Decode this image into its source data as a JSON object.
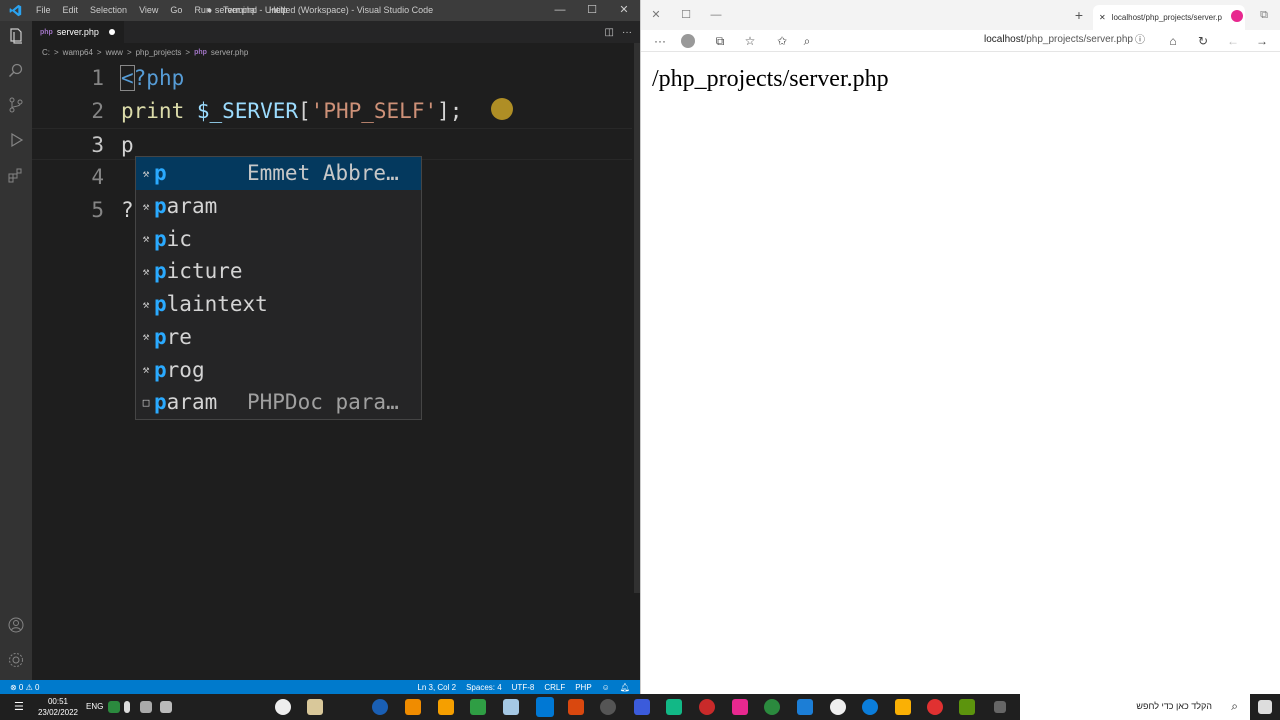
{
  "vscode": {
    "menu": [
      "File",
      "Edit",
      "Selection",
      "View",
      "Go",
      "Run",
      "Terminal",
      "Help"
    ],
    "window_title": "● server.php - Untitled (Workspace) - Visual Studio Code",
    "tab_label": "server.php",
    "breadcrumb": [
      "C:",
      ">",
      "wamp64",
      ">",
      "www",
      ">",
      "php_projects",
      ">",
      "server.php"
    ],
    "code_lines": [
      {
        "num": "1"
      },
      {
        "num": "2"
      },
      {
        "num": "3",
        "text": "p"
      },
      {
        "num": "4"
      },
      {
        "num": "5",
        "text": "?"
      }
    ],
    "code": {
      "l1_open": "<",
      "l1_rest": "?php",
      "l2_print": "print ",
      "l2_var": "$_SERVER",
      "l2_open": "[",
      "l2_str": "'PHP_SELF'",
      "l2_close": "];"
    },
    "suggestions": [
      {
        "prefix": "p",
        "rest": "",
        "detail": "Emmet Abbre…",
        "icon": "wrench-icon",
        "selected": true
      },
      {
        "prefix": "p",
        "rest": "aram",
        "detail": "",
        "icon": "wrench-icon"
      },
      {
        "prefix": "p",
        "rest": "ic",
        "detail": "",
        "icon": "wrench-icon"
      },
      {
        "prefix": "p",
        "rest": "icture",
        "detail": "",
        "icon": "wrench-icon"
      },
      {
        "prefix": "p",
        "rest": "laintext",
        "detail": "",
        "icon": "wrench-icon"
      },
      {
        "prefix": "p",
        "rest": "re",
        "detail": "",
        "icon": "wrench-icon"
      },
      {
        "prefix": "p",
        "rest": "rog",
        "detail": "",
        "icon": "wrench-icon"
      },
      {
        "prefix": "p",
        "rest": "aram",
        "detail": "PHPDoc para…",
        "icon": "snippet-icon"
      }
    ],
    "status": {
      "problems": "⊗ 0 ⚠ 0",
      "position": "Ln 3, Col 2",
      "spaces": "Spaces: 4",
      "encoding": "UTF-8",
      "eol": "CRLF",
      "language": "PHP"
    }
  },
  "edge": {
    "tab_title": "localhost/php_projects/server.p",
    "address_host": "localhost",
    "address_path": "/php_projects/server.php",
    "page_output": "/php_projects/server.php"
  },
  "taskbar": {
    "time": "00:51",
    "date": "23/02/2022",
    "lang": "ENG",
    "search_placeholder": "הקלד כאן כדי לחפש"
  },
  "colors": {
    "accent": "#007acc",
    "suggest_highlight": "#2aaaff",
    "string": "#ce9178"
  }
}
